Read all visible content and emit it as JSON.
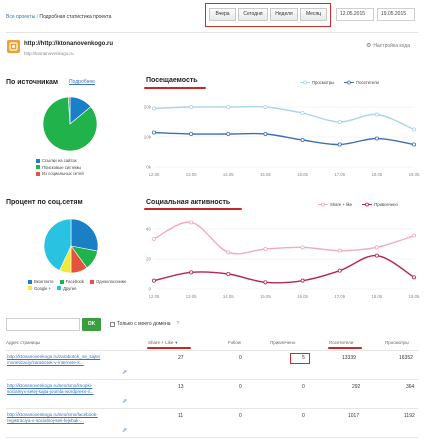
{
  "breadcrumb": {
    "all_projects": "Все проекты",
    "sep": "/",
    "current": "Подробная статистика проекта"
  },
  "period_buttons": [
    "Вчера",
    "Сегодня",
    "Неделя",
    "Месяц"
  ],
  "date_from": "12.05.2015",
  "date_to": "19.05.2015",
  "project": {
    "url": "http://http://ktonanovenkogo.ru",
    "sub": "http://ktonanovenkogo.ru",
    "settings_label": "Настройка кода"
  },
  "sources": {
    "title": "По источникам",
    "more_link": "Подробнее",
    "legend": [
      "Ссылки на сайтах",
      "Поисковые системы",
      "Из социальных сетей"
    ],
    "colors": [
      "#1a7fc7",
      "#22b24c",
      "#e6533c"
    ],
    "chart_data": {
      "type": "pie",
      "labels": [
        "Ссылки на сайтах",
        "Поисковые системы",
        "Из социальных сетей"
      ],
      "values": [
        14,
        85,
        1
      ]
    }
  },
  "attendance": {
    "title": "Посещаемость",
    "legend": [
      "Просмотры",
      "Посетители"
    ],
    "chart_data": {
      "type": "line",
      "x": [
        "12.05",
        "13.05",
        "14.05",
        "15.05",
        "16.05",
        "17.05",
        "18.05",
        "19.05"
      ],
      "series": [
        {
          "name": "Просмотры",
          "color": "#a9d5ea",
          "values": [
            19500,
            20000,
            20000,
            20000,
            18000,
            15000,
            17500,
            12500
          ]
        },
        {
          "name": "Посетители",
          "color": "#3f6fae",
          "values": [
            11500,
            11000,
            11000,
            11000,
            9000,
            7500,
            9500,
            7500
          ]
        }
      ],
      "yticks": [
        "20k",
        "10k",
        "0k"
      ],
      "ylim": [
        0,
        25000
      ]
    }
  },
  "social_share": {
    "title": "Процент по соц.сетям",
    "legend": [
      "Вконтакте",
      "Facebook",
      "Одноклассники",
      "Google +",
      "Другие"
    ],
    "colors": [
      "#1a7fc7",
      "#22b24c",
      "#e6533c",
      "#f2e93a",
      "#29c2e0"
    ],
    "chart_data": {
      "type": "pie",
      "labels": [
        "Вконтакте",
        "Facebook",
        "Одноклассники",
        "Google +",
        "Другие"
      ],
      "values": [
        28,
        12,
        10,
        7,
        43
      ]
    }
  },
  "social_activity": {
    "title": "Социальная активность",
    "legend": [
      "Share + like",
      "Привлечено"
    ],
    "chart_data": {
      "type": "line",
      "x": [
        "12.05",
        "13.05",
        "14.05",
        "15.05",
        "16.05",
        "17.05",
        "18.05",
        "19.05"
      ],
      "series": [
        {
          "name": "Share + like",
          "color": "#f4a8c4",
          "values": [
            30,
            40,
            22,
            24,
            25,
            23,
            25,
            32
          ]
        },
        {
          "name": "Привлечено",
          "color": "#b5245a",
          "values": [
            5,
            10,
            9,
            4,
            5,
            11,
            20,
            7
          ]
        }
      ],
      "yticks": [
        "40",
        "20",
        "0"
      ],
      "ylim": [
        0,
        45
      ]
    }
  },
  "filter": {
    "ok_label": "OK",
    "checkbox_label": "Только с моего домена",
    "help": "?"
  },
  "table": {
    "headers": [
      "Адрес страницы",
      "Share + Like",
      "Follow",
      "Привлечено",
      "Посетители",
      "Просмотры"
    ],
    "rows": [
      {
        "url1": "http://ktonanovenkogo.ru/zarabotok_na_sajte/",
        "url2": "monetizaciy/zarabotok-v-internete-k...",
        "share": "27",
        "follow": "0",
        "attracted": "5",
        "visitors": "13339",
        "views": "16352"
      },
      {
        "url1": "http://ktonanovenkogo.ru/seo/smo/knopki-",
        "url2": "socialnyx-setej-sajta-joomla-wordpress-il...",
        "share": "13",
        "follow": "0",
        "attracted": "0",
        "visitors": "292",
        "views": "364"
      },
      {
        "url1": "http://ktonanovenkogo.ru/seo/smo/facebook-",
        "url2": "registraciya-v-socialnoj-seti-fejsbuk-...",
        "share": "11",
        "follow": "0",
        "attracted": "0",
        "visitors": "1017",
        "views": "1192"
      }
    ]
  }
}
